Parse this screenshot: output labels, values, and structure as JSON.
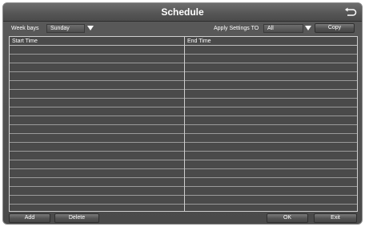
{
  "window": {
    "title": "Schedule"
  },
  "icons": {
    "back": "back-arrow-icon",
    "dropdown": "triangle-down-icon"
  },
  "toolbar": {
    "weekdays_label": "Week bays",
    "weekday_value": "Sunday",
    "apply_label": "Apply Settings TO",
    "apply_value": "All",
    "copy_label": "Copy"
  },
  "table": {
    "columns": [
      "Start Time",
      "End Time"
    ],
    "rows": [
      [
        "",
        ""
      ],
      [
        "",
        ""
      ],
      [
        "",
        ""
      ],
      [
        "",
        ""
      ],
      [
        "",
        ""
      ],
      [
        "",
        ""
      ],
      [
        "",
        ""
      ],
      [
        "",
        ""
      ],
      [
        "",
        ""
      ],
      [
        "",
        ""
      ],
      [
        "",
        ""
      ],
      [
        "",
        ""
      ],
      [
        "",
        ""
      ],
      [
        "",
        ""
      ],
      [
        "",
        ""
      ],
      [
        "",
        ""
      ],
      [
        "",
        ""
      ],
      [
        "",
        ""
      ]
    ]
  },
  "footer": {
    "add_label": "Add",
    "delete_label": "Delete",
    "ok_label": "OK",
    "exit_label": "Exit"
  },
  "colors": {
    "panel": "#4a4a4a",
    "grid_line": "#9a9a9a",
    "text": "#ffffff"
  }
}
